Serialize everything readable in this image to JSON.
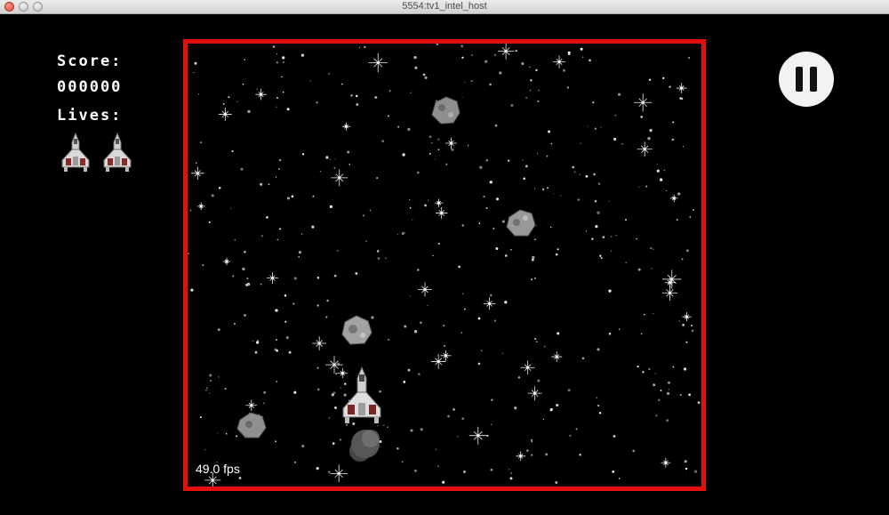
{
  "window": {
    "title": "5554:tv1_intel_host"
  },
  "hud": {
    "score_label": "Score:",
    "score_value": "000000",
    "lives_label": "Lives:",
    "lives_count": 2
  },
  "pause_button": {
    "icon": "pause-icon"
  },
  "playfield": {
    "border_color": "#e20f0f",
    "fps_text": "49.0 fps"
  }
}
